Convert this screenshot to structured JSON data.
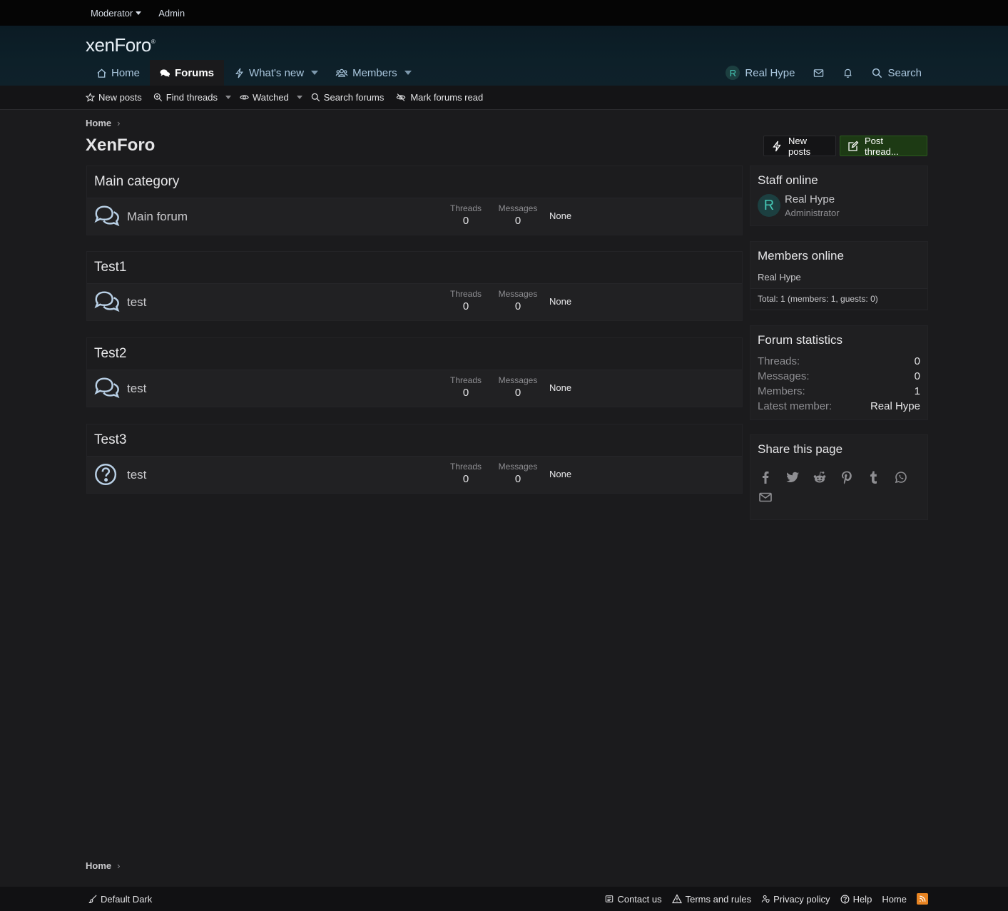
{
  "staffbar": {
    "moderator": "Moderator",
    "admin": "Admin"
  },
  "header": {
    "logo": "xenForo",
    "logo_mark": "®",
    "nav": {
      "home": "Home",
      "forums": "Forums",
      "whats_new": "What's new",
      "members": "Members"
    },
    "user": {
      "initial": "R",
      "name": "Real Hype"
    },
    "search": "Search"
  },
  "subnav": {
    "new_posts": "New posts",
    "find_threads": "Find threads",
    "watched": "Watched",
    "search_forums": "Search forums",
    "mark_read": "Mark forums read"
  },
  "breadcrumb": {
    "home": "Home"
  },
  "page": {
    "title": "XenForo",
    "new_posts_btn": "New posts",
    "post_thread_btn": "Post thread..."
  },
  "categories": [
    {
      "title": "Main category",
      "node": {
        "title": "Main forum",
        "icon": "comments-icon",
        "threads_label": "Threads",
        "threads": "0",
        "messages_label": "Messages",
        "messages": "0",
        "last_post": "None"
      }
    },
    {
      "title": "Test1",
      "node": {
        "title": "test",
        "icon": "comments-icon",
        "threads_label": "Threads",
        "threads": "0",
        "messages_label": "Messages",
        "messages": "0",
        "last_post": "None"
      }
    },
    {
      "title": "Test2",
      "node": {
        "title": "test",
        "icon": "comments-icon",
        "threads_label": "Threads",
        "threads": "0",
        "messages_label": "Messages",
        "messages": "0",
        "last_post": "None"
      }
    },
    {
      "title": "Test3",
      "node": {
        "title": "test",
        "icon": "question-circle-icon",
        "threads_label": "Threads",
        "threads": "0",
        "messages_label": "Messages",
        "messages": "0",
        "last_post": "None"
      }
    }
  ],
  "sidebar": {
    "staff": {
      "title": "Staff online",
      "initial": "R",
      "name": "Real Hype",
      "role": "Administrator"
    },
    "members_online": {
      "title": "Members online",
      "list": "Real Hype",
      "total": "Total: 1 (members: 1, guests: 0)"
    },
    "stats": {
      "title": "Forum statistics",
      "rows": [
        {
          "k": "Threads:",
          "v": "0"
        },
        {
          "k": "Messages:",
          "v": "0"
        },
        {
          "k": "Members:",
          "v": "1"
        },
        {
          "k": "Latest member:",
          "v": "Real Hype"
        }
      ]
    },
    "share": {
      "title": "Share this page",
      "icons": [
        "facebook-icon",
        "twitter-icon",
        "reddit-icon",
        "pinterest-icon",
        "tumblr-icon",
        "whatsapp-icon",
        "email-icon"
      ]
    }
  },
  "footer": {
    "style": "Default Dark",
    "contact": "Contact us",
    "terms": "Terms and rules",
    "privacy": "Privacy policy",
    "help": "Help",
    "home": "Home"
  },
  "colors": {
    "accent": "#a9c6dd",
    "post_btn": "#1d3a14",
    "avatar_bg": "#1c3f40",
    "avatar_fg": "#45c6b4",
    "rss": "#e88422"
  }
}
